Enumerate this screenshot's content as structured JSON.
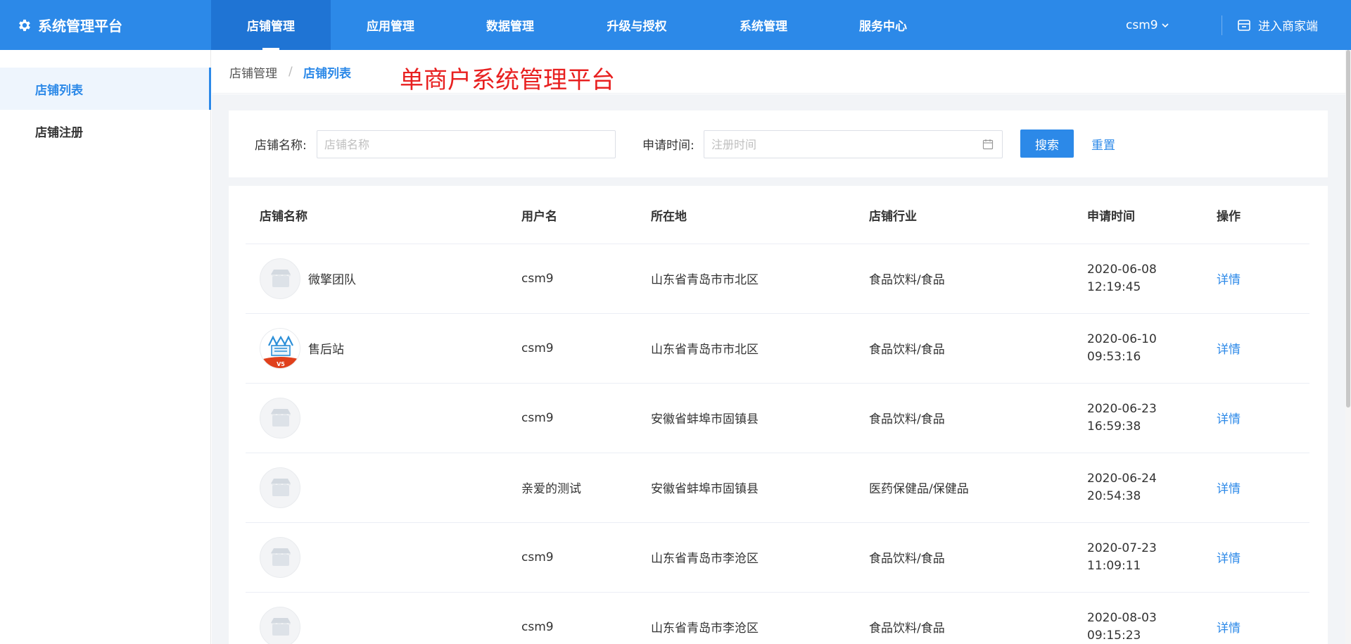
{
  "header": {
    "brand": "系统管理平台",
    "nav": [
      {
        "label": "店铺管理",
        "active": true
      },
      {
        "label": "应用管理",
        "active": false
      },
      {
        "label": "数据管理",
        "active": false
      },
      {
        "label": "升级与授权",
        "active": false
      },
      {
        "label": "系统管理",
        "active": false
      },
      {
        "label": "服务中心",
        "active": false
      }
    ],
    "user": "csm9",
    "merchant_link": "进入商家端"
  },
  "sidebar": {
    "items": [
      {
        "label": "店铺列表",
        "active": true
      },
      {
        "label": "店铺注册",
        "active": false
      }
    ]
  },
  "breadcrumb": {
    "parent": "店铺管理",
    "separator": "/",
    "current": "店铺列表"
  },
  "annotation": "单商户系统管理平台",
  "filters": {
    "name_label": "店铺名称:",
    "name_placeholder": "店铺名称",
    "time_label": "申请时间:",
    "time_placeholder": "注册时间",
    "search_button": "搜索",
    "reset_button": "重置"
  },
  "table": {
    "columns": [
      "店铺名称",
      "用户名",
      "所在地",
      "店铺行业",
      "申请时间",
      "操作"
    ],
    "rows": [
      {
        "name": "微擎团队",
        "avatar": "store-placeholder",
        "user": "csm9",
        "location": "山东省青岛市市北区",
        "industry": "食品饮料/食品",
        "date": "2020-06-08",
        "time": "12:19:45",
        "action": "详情"
      },
      {
        "name": "售后站",
        "avatar": "mall-logo",
        "user": "csm9",
        "location": "山东省青岛市市北区",
        "industry": "食品饮料/食品",
        "date": "2020-06-10",
        "time": "09:53:16",
        "action": "详情"
      },
      {
        "name": "",
        "avatar": "store-placeholder",
        "user": "csm9",
        "location": "安徽省蚌埠市固镇县",
        "industry": "食品饮料/食品",
        "date": "2020-06-23",
        "time": "16:59:38",
        "action": "详情"
      },
      {
        "name": "",
        "avatar": "store-placeholder",
        "user": "亲爱的测试",
        "location": "安徽省蚌埠市固镇县",
        "industry": "医药保健品/保健品",
        "date": "2020-06-24",
        "time": "20:54:38",
        "action": "详情"
      },
      {
        "name": "",
        "avatar": "store-placeholder",
        "user": "csm9",
        "location": "山东省青岛市李沧区",
        "industry": "食品饮料/食品",
        "date": "2020-07-23",
        "time": "11:09:11",
        "action": "详情"
      },
      {
        "name": "",
        "avatar": "store-placeholder",
        "user": "csm9",
        "location": "山东省青岛市李沧区",
        "industry": "食品饮料/食品",
        "date": "2020-08-03",
        "time": "09:15:23",
        "action": "详情"
      }
    ]
  },
  "colors": {
    "primary": "#2c89e8",
    "nav_active": "#1f74d4",
    "annotation": "#e82020",
    "content_bg": "#f2f4f7"
  }
}
